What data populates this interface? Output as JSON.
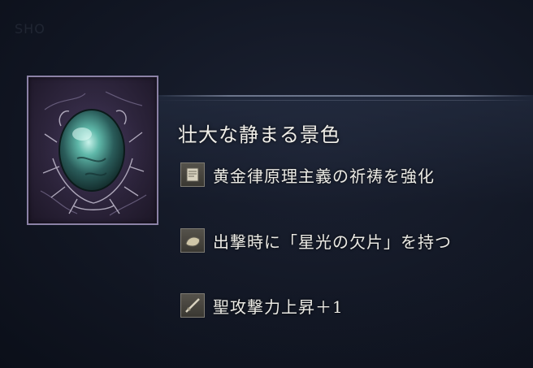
{
  "item": {
    "name": "壮大な静まる景色",
    "icon": "talisman-stone-icon"
  },
  "effects": [
    {
      "icon": "scroll-icon",
      "text": "黄金律原理主義の祈祷を強化"
    },
    {
      "icon": "stone-shard-icon",
      "text": "出撃時に「星光の欠片」を持つ"
    },
    {
      "icon": "sword-icon",
      "text": "聖攻撃力上昇＋1"
    }
  ],
  "colors": {
    "background": "#121724",
    "frame_border": "#8c82a6",
    "text": "#ecebe5"
  }
}
